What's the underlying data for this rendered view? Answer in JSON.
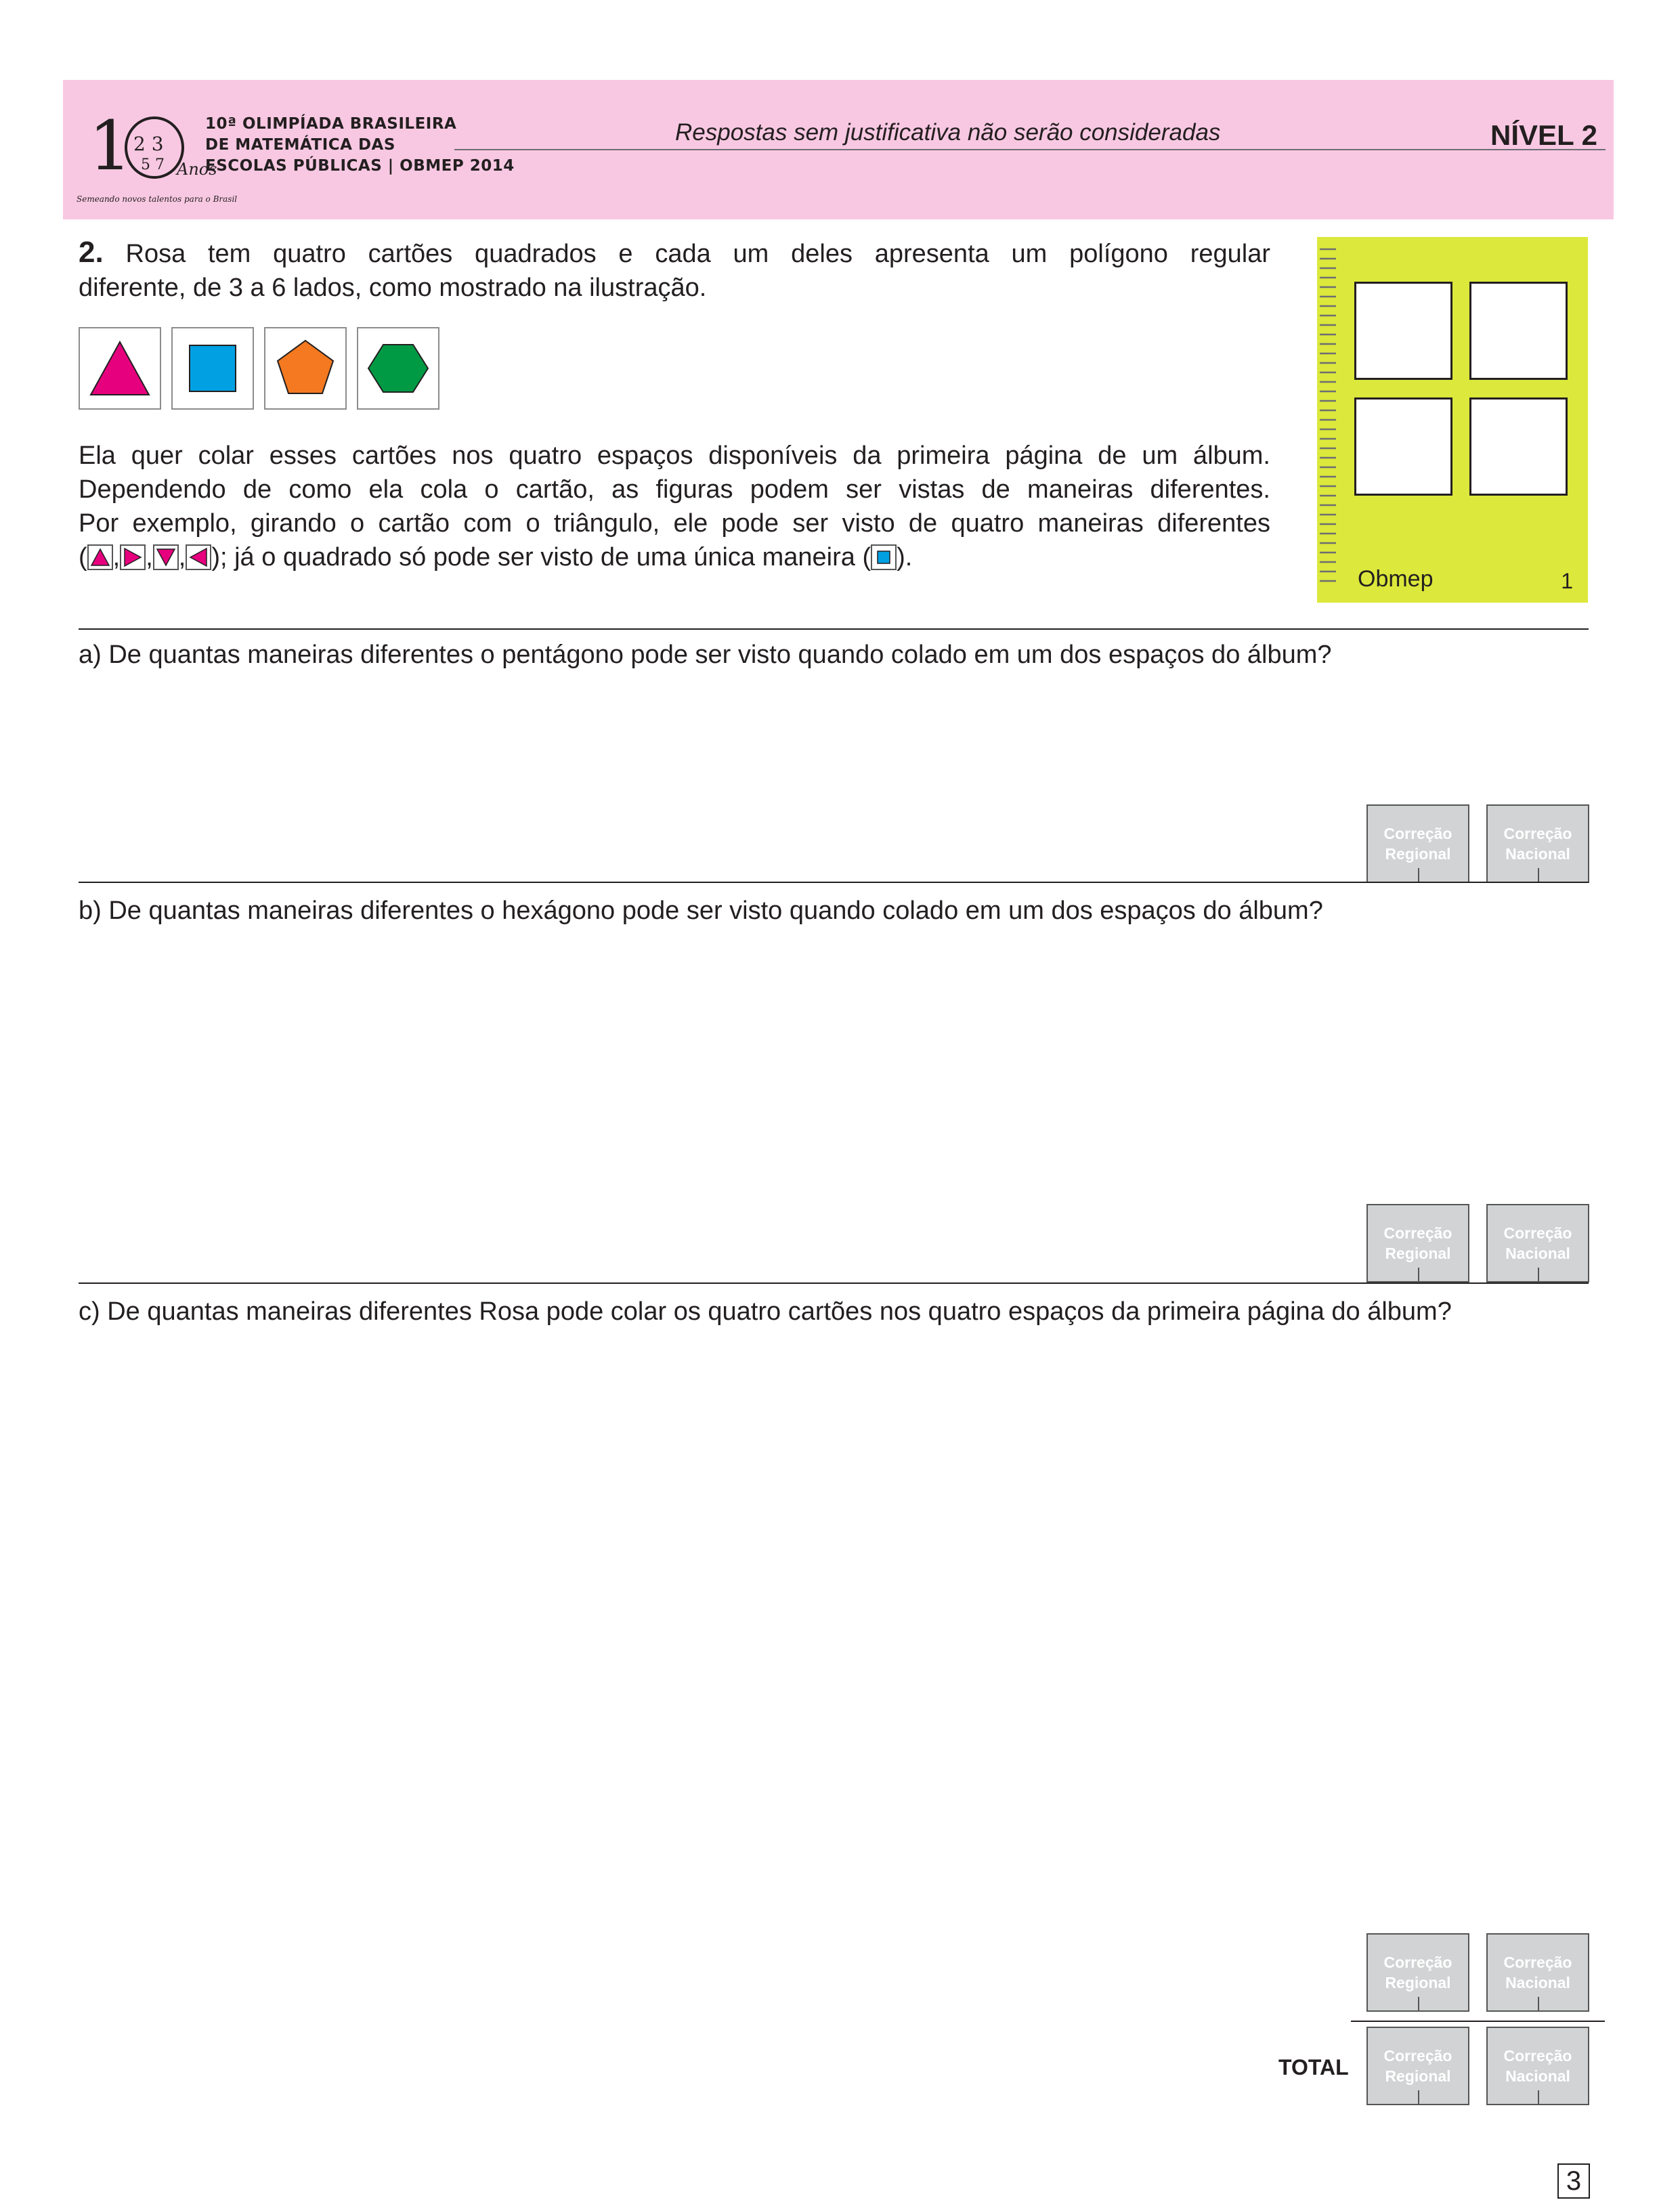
{
  "header": {
    "logo_text": "10 Anos",
    "logo_tagline": "Semeando novos talentos para o Brasil",
    "org_line1": "10ª OLIMPÍADA BRASILEIRA",
    "org_line2": "DE MATEMÁTICA DAS",
    "org_line3": "ESCOLAS PÚBLICAS | OBMEP 2014",
    "notice": "Respostas sem justificativa não serão consideradas",
    "level": "NÍVEL 2"
  },
  "problem": {
    "number": "2.",
    "intro_line1": "Rosa tem quatro cartões quadrados e cada um deles apresenta um polígono regular",
    "intro_line2": "diferente, de 3 a 6 lados, como mostrado na ilustração.",
    "cards": [
      {
        "shape": "triangle",
        "color": "#e6007e"
      },
      {
        "shape": "square",
        "color": "#00a0e3"
      },
      {
        "shape": "pentagon",
        "color": "#f47920"
      },
      {
        "shape": "hexagon",
        "color": "#009a44"
      }
    ],
    "body_line1": "Ela quer colar esses cartões nos quatro espaços disponíveis da primeira página de um álbum.",
    "body_line2": "Dependendo de como ela cola o cartão, as figuras podem ser vistas de maneiras diferentes.",
    "body_line3": "Por exemplo, girando o cartão com o triângulo, ele pode ser visto de quatro maneiras diferentes",
    "body_line4_open": "(",
    "body_line4_sep": ",",
    "body_line4_mid": "); já o quadrado só pode ser visto de uma única maneira (",
    "body_line4_close": ")."
  },
  "album": {
    "title": "Obmep",
    "page": "1",
    "color": "#dce83b"
  },
  "questions": {
    "a": "a) De quantas maneiras diferentes o pentágono pode ser visto quando colado em um dos espaços do álbum?",
    "b": "b) De quantas maneiras diferentes o hexágono pode ser visto quando colado em um dos espaços do álbum?",
    "c": "c) De quantas maneiras diferentes Rosa pode colar os quatro cartões nos quatro espaços da primeira página do álbum?"
  },
  "grading": {
    "regional_line1": "Correção",
    "regional_line2": "Regional",
    "national_line1": "Correção",
    "national_line2": "Nacional",
    "total_label": "TOTAL"
  },
  "footer": {
    "page_number": "3"
  }
}
